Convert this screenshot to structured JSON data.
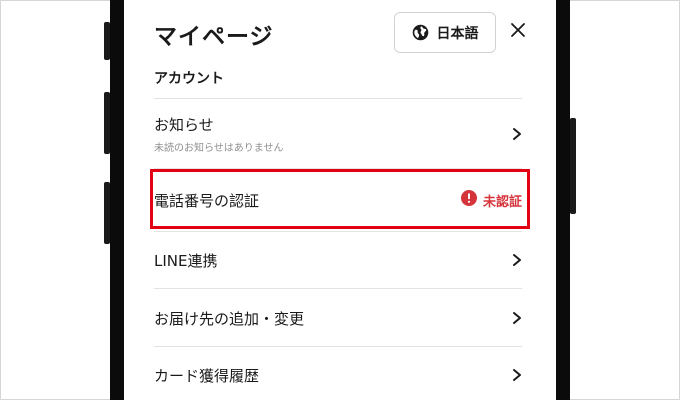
{
  "header": {
    "title": "マイページ",
    "language_button": {
      "label": "日本語",
      "icon": "globe-icon"
    },
    "close_icon": "close-icon"
  },
  "account": {
    "section_title": "アカウント",
    "items": [
      {
        "label": "お知らせ",
        "sublabel": "未読のお知らせはありません",
        "icon": "chevron-right-icon"
      },
      {
        "label": "電話番号の認証",
        "status": "未認証",
        "status_icon": "alert-circle-icon",
        "highlighted": true
      },
      {
        "label": "LINE連携",
        "icon": "chevron-right-icon"
      },
      {
        "label": "お届け先の追加・変更",
        "icon": "chevron-right-icon"
      },
      {
        "label": "カード獲得履歴",
        "icon": "chevron-right-icon"
      }
    ]
  },
  "colors": {
    "highlight": "#e20012",
    "status": "#d6343b",
    "text": "#1a1a1a"
  }
}
